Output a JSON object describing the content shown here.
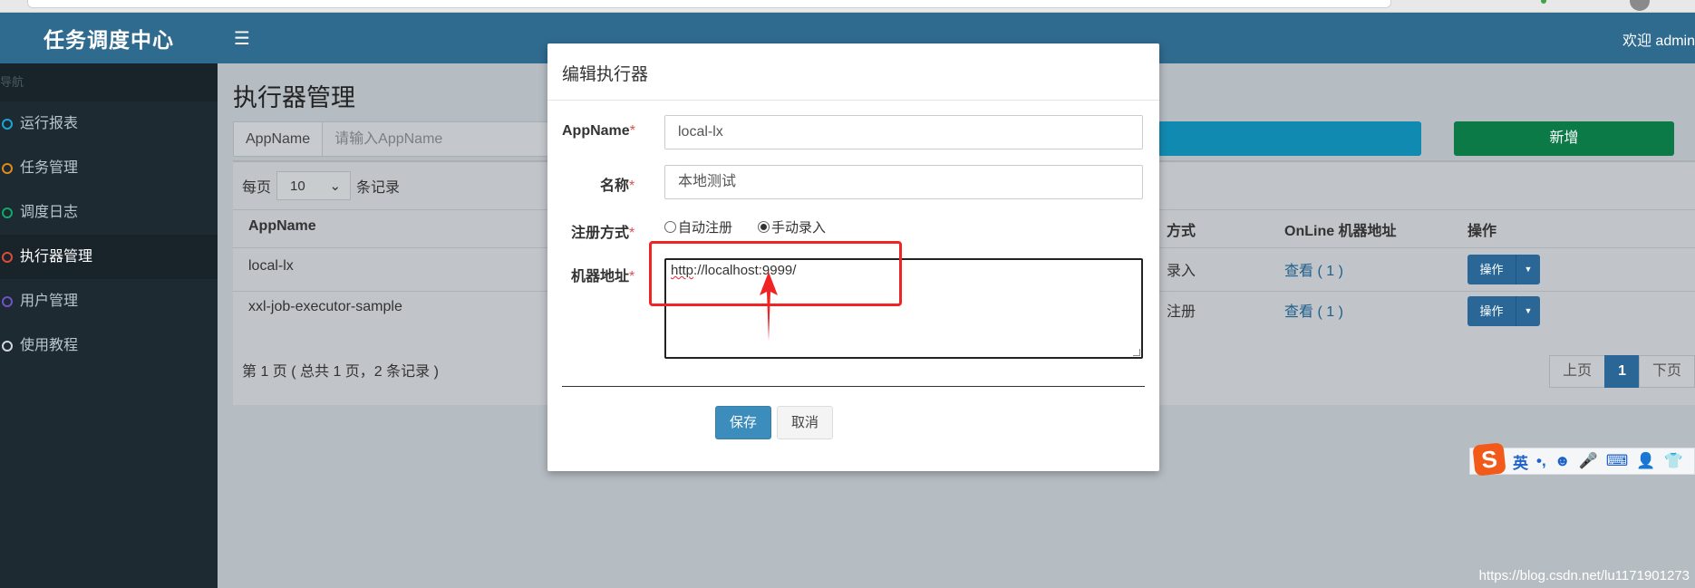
{
  "app": {
    "brand": "任务调度中心",
    "welcome": "欢迎 admin"
  },
  "sidebar": {
    "header": "导航",
    "items": [
      {
        "label": "运行报表",
        "color": "#1aa5d8"
      },
      {
        "label": "任务管理",
        "color": "#e08a1e"
      },
      {
        "label": "调度日志",
        "color": "#11a868"
      },
      {
        "label": "执行器管理",
        "color": "#dd4b39"
      },
      {
        "label": "用户管理",
        "color": "#6f52c6"
      },
      {
        "label": "使用教程",
        "color": "#d2d6de"
      }
    ]
  },
  "page": {
    "title": "执行器管理",
    "search_addon": "AppName",
    "search_placeholder": "请输入AppName",
    "add_label": "新增",
    "per_page_prefix": "每页",
    "per_page_value": "10",
    "per_page_suffix": "条记录",
    "page_info": "第 1 页 ( 总共 1 页，2 条记录 )",
    "pager": {
      "prev": "上页",
      "current": "1",
      "next": "下页"
    }
  },
  "table": {
    "headers": {
      "appname": "AppName",
      "method_tail": "方式",
      "online": "OnLine 机器地址",
      "ops": "操作"
    },
    "rows": [
      {
        "appname": "local-lx",
        "method_tail": "录入",
        "online": "查看 ( 1 )",
        "op": "操作"
      },
      {
        "appname": "xxl-job-executor-sample",
        "method_tail": "注册",
        "online": "查看 ( 1 )",
        "op": "操作"
      }
    ]
  },
  "modal": {
    "title": "编辑执行器",
    "required_mark": "*",
    "appname_label": "AppName",
    "appname_value": "local-lx",
    "name_label": "名称",
    "name_value": "本地测试",
    "reg_label": "注册方式",
    "reg_auto": "自动注册",
    "reg_manual": "手动录入",
    "address_label": "机器地址",
    "address_scheme": "http",
    "address_rest": "://localhost:9999/",
    "save": "保存",
    "cancel": "取消"
  },
  "ime": {
    "logo": "S",
    "mode": "英",
    "punct": "•,",
    "emoji": "☻",
    "mic": "🎤",
    "kbd": "⌨",
    "user": "👤",
    "skin": "👕"
  },
  "watermark": "https://blog.csdn.net/lu1171901273"
}
